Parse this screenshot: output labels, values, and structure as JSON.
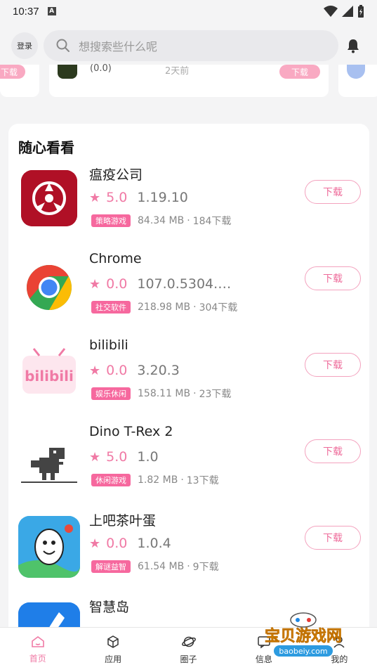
{
  "status": {
    "time": "10:37",
    "a_icon": "A"
  },
  "header": {
    "login_label": "登录",
    "search_placeholder": "想搜索些什么呢"
  },
  "strip": {
    "download_label": "下载",
    "rating_text": "(0.0)",
    "time_text": "2天前"
  },
  "section": {
    "title": "随心看看"
  },
  "apps": [
    {
      "name": "瘟疫公司",
      "score": "5.0",
      "version": "1.19.10",
      "tag": "策略游戏",
      "size": "84.34 MB",
      "downloads": "184下载",
      "button": "下载",
      "icon": "plague-inc-icon"
    },
    {
      "name": "Chrome",
      "score": "0.0",
      "version": "107.0.5304.1…",
      "tag": "社交软件",
      "size": "218.98 MB",
      "downloads": "304下载",
      "button": "下载",
      "icon": "chrome-icon"
    },
    {
      "name": "bilibili",
      "score": "0.0",
      "version": "3.20.3",
      "tag": "娱乐休闲",
      "size": "158.11 MB",
      "downloads": "23下载",
      "button": "下载",
      "icon": "bilibili-icon"
    },
    {
      "name": "Dino T-Rex 2",
      "score": "5.0",
      "version": "1.0",
      "tag": "休闲游戏",
      "size": "1.82 MB",
      "downloads": "13下载",
      "button": "下载",
      "icon": "dino-icon"
    },
    {
      "name": "上吧茶叶蛋",
      "score": "0.0",
      "version": "1.0.4",
      "tag": "解谜益智",
      "size": "61.54 MB",
      "downloads": "9下载",
      "button": "下载",
      "icon": "egg-game-icon"
    },
    {
      "name": "智慧岛",
      "icon": "zhihuidao-icon"
    }
  ],
  "separator": "·",
  "tabs": [
    {
      "label": "首页",
      "icon": "home-icon"
    },
    {
      "label": "应用",
      "icon": "cube-icon"
    },
    {
      "label": "圈子",
      "icon": "planet-icon"
    },
    {
      "label": "信息",
      "icon": "message-icon"
    },
    {
      "label": "我的",
      "icon": "user-icon"
    }
  ],
  "watermark": {
    "title": "宝贝游戏网",
    "url": "baobeiy.com"
  },
  "colors": {
    "accent": "#f07aa5",
    "tag": "#f6689e",
    "background": "#f4f4f5"
  }
}
